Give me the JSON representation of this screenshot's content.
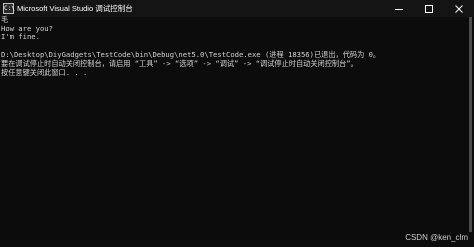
{
  "window": {
    "title": "Microsoft Visual Studio 调试控制台",
    "icon": "vs-debug-console-icon",
    "icon_glyph": "C:\\",
    "caption": {
      "minimize_icon": "minimize-icon",
      "maximize_icon": "maximize-icon",
      "close_icon": "close-icon"
    }
  },
  "console": {
    "lines": [
      "毛",
      "How are you?",
      "I'm fine.",
      "D:\\Desktop\\DiyGadgets\\TestCode\\bin\\Debug\\net5.0\\TestCode.exe (进程 18356)已退出，代码为 0。",
      "要在调试停止时自动关闭控制台，请启用 “工具” -> “选项” -> “调试” -> “调试停止时自动关闭控制台”。",
      "按任意键关闭此窗口. . ."
    ]
  },
  "watermark": "CSDN @ken_clm",
  "colors": {
    "background": "#0c0c0c",
    "titlebar": "#141414",
    "text": "#d4d4d4"
  }
}
